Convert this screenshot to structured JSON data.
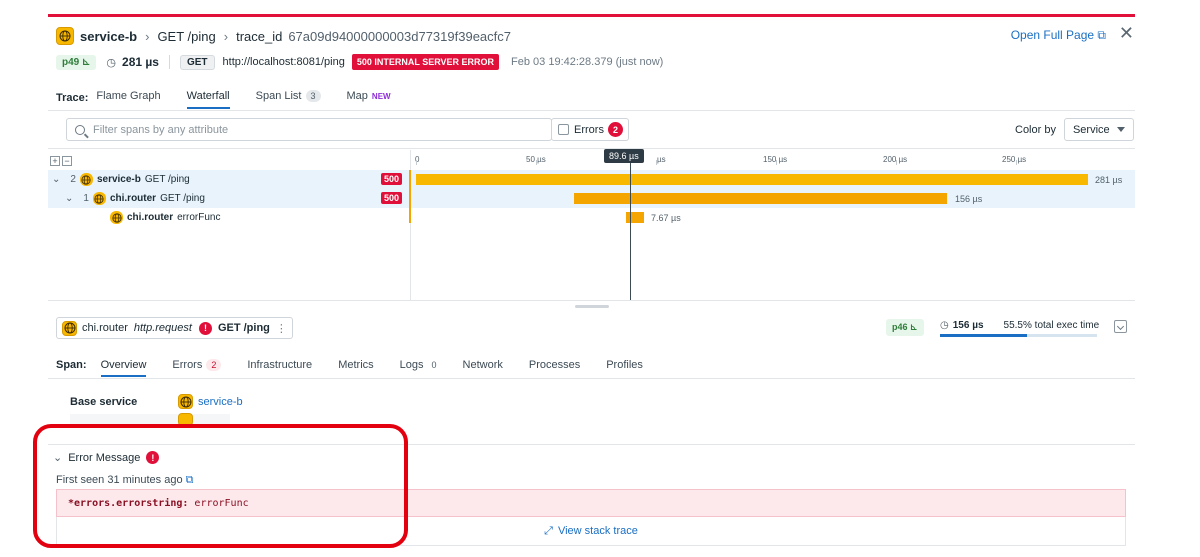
{
  "header": {
    "service": "service-b",
    "endpoint": "GET /ping",
    "trace_label": "trace_id",
    "trace_id": "67a09d94000000003d77319f39eacfc7",
    "open_full": "Open Full Page"
  },
  "meta": {
    "percentile": "p49",
    "duration": "281 µs",
    "method": "GET",
    "url": "http://localhost:8081/ping",
    "status": "500 INTERNAL SERVER ERROR",
    "timestamp": "Feb 03 19:42:28.379 (just now)"
  },
  "trace_tabs": {
    "label": "Trace:",
    "flame": "Flame Graph",
    "waterfall": "Waterfall",
    "spanlist": "Span List",
    "spanlist_count": "3",
    "map": "Map",
    "map_badge": "NEW"
  },
  "filter": {
    "placeholder": "Filter spans by any attribute",
    "errors_label": "Errors",
    "errors_count": "2",
    "colorby_label": "Color by",
    "colorby_value": "Service"
  },
  "waterfall": {
    "cursor": "89.6 µs",
    "ticks": [
      "0",
      "50 µs",
      "µs",
      "150 µs",
      "200 µs",
      "250 µs"
    ],
    "spans": [
      {
        "count": "2",
        "service": "service-b",
        "resource": "GET /ping",
        "code": "500",
        "duration": "281 µs"
      },
      {
        "count": "1",
        "service": "chi.router",
        "resource": "GET /ping",
        "code": "500",
        "duration": "156 µs"
      },
      {
        "count": "",
        "service": "chi.router",
        "resource": "errorFunc",
        "code": "",
        "duration": "7.67 µs"
      }
    ]
  },
  "span_detail": {
    "service": "chi.router",
    "operation": "http.request",
    "resource": "GET /ping",
    "percentile": "p46",
    "duration": "156 µs",
    "exec_time": "55.5% total exec time",
    "exec_fraction": 0.555
  },
  "span_tabs": {
    "label": "Span:",
    "overview": "Overview",
    "errors": "Errors",
    "errors_count": "2",
    "infra": "Infrastructure",
    "metrics": "Metrics",
    "logs": "Logs",
    "logs_count": "0",
    "network": "Network",
    "processes": "Processes",
    "profiles": "Profiles"
  },
  "overview": {
    "base_service_label": "Base service",
    "base_service_value": "service-b"
  },
  "error": {
    "title": "Error Message",
    "first_seen": "First seen 31 minutes ago",
    "type": "*errors.errorstring:",
    "message": "errorFunc",
    "stack_link": "View stack trace"
  }
}
